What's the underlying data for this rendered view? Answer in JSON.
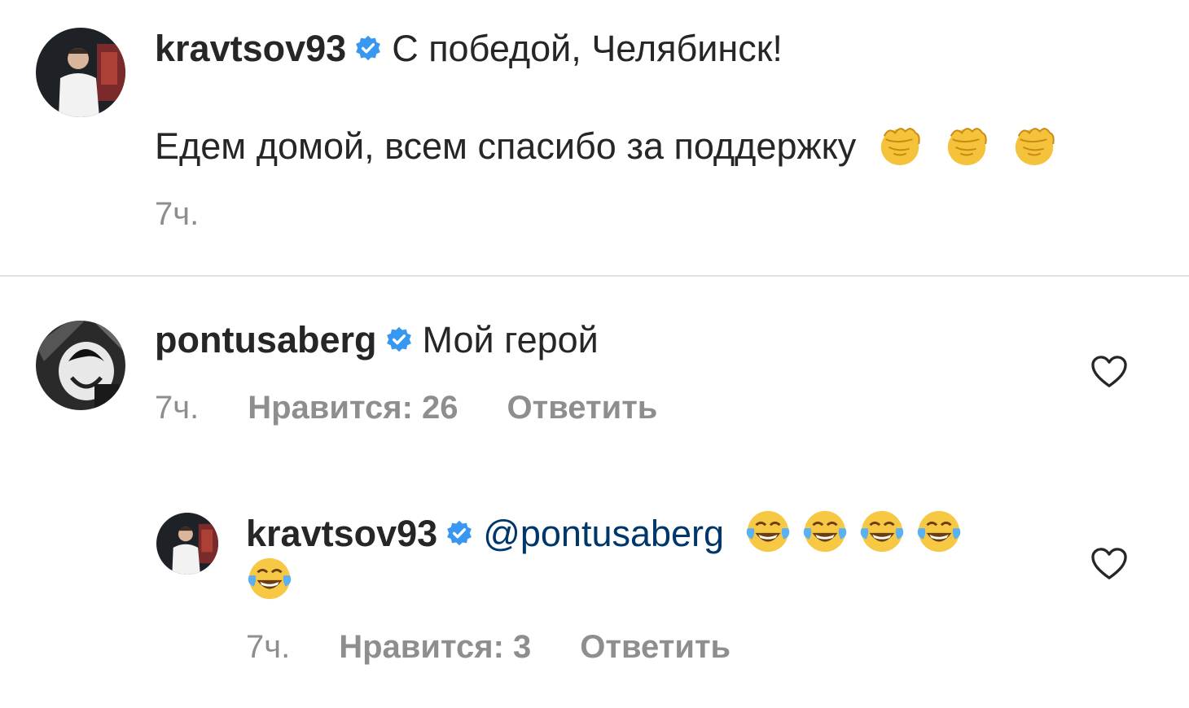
{
  "caption": {
    "username": "kravtsov93",
    "text": "С победой, Челябинск!",
    "body": "Едем домой, всем спасибо за поддержку",
    "emoji": [
      "fist-emoji",
      "fist-emoji",
      "fist-emoji"
    ],
    "time": "7ч."
  },
  "comments": [
    {
      "username": "pontusaberg",
      "text": "Мой герой",
      "time": "7ч.",
      "likes_label": "Нравится: 26",
      "reply_label": "Ответить"
    },
    {
      "username": "kravtsov93",
      "mention": "@pontusaberg",
      "emoji": [
        "joy-emoji",
        "joy-emoji",
        "joy-emoji",
        "joy-emoji",
        "joy-emoji"
      ],
      "time": "7ч.",
      "likes_label": "Нравится: 3",
      "reply_label": "Ответить"
    }
  ],
  "colors": {
    "verified": "#3897f0",
    "mention": "#00376b",
    "meta": "#8e8e8e",
    "text": "#262626"
  }
}
